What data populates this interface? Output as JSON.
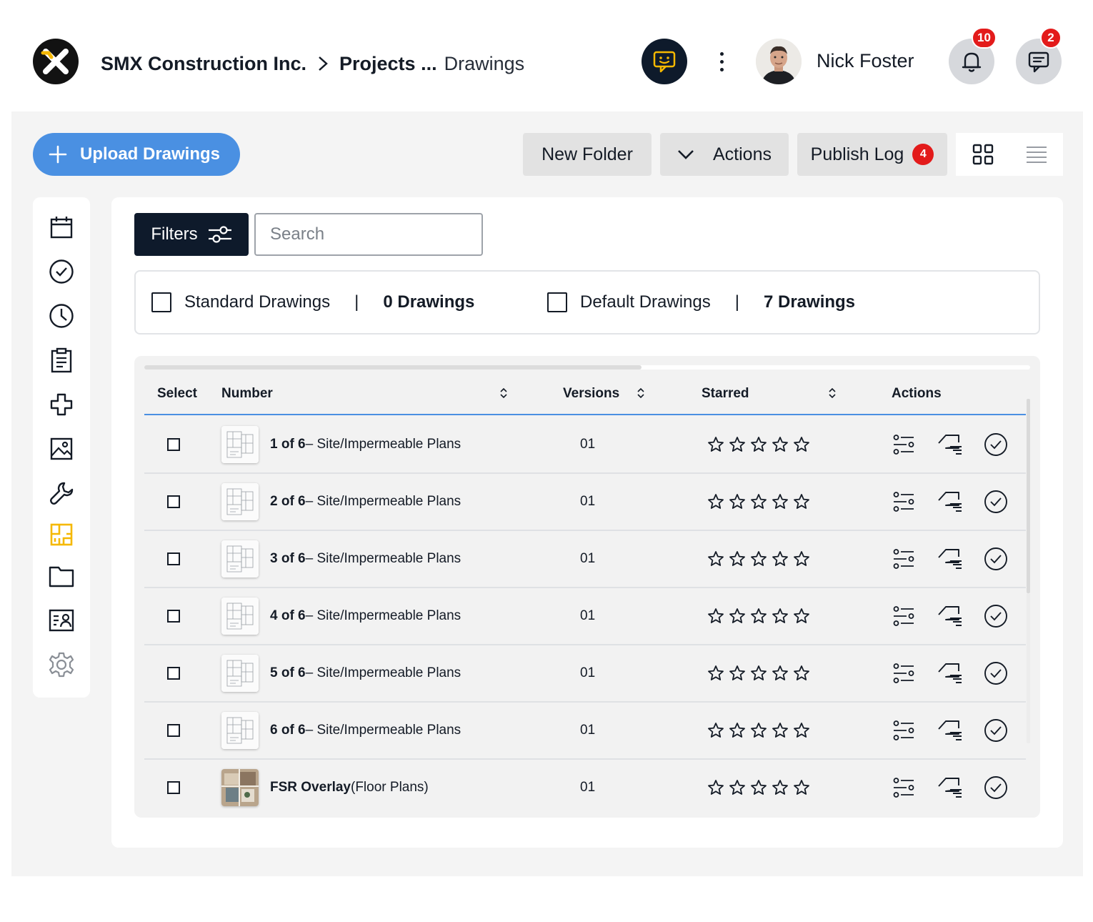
{
  "header": {
    "company": "SMX Construction Inc.",
    "section": "Projects ...",
    "page": "Drawings",
    "user_name": "Nick Foster",
    "notifications_count": "10",
    "messages_count": "2"
  },
  "toolbar": {
    "upload_label": "Upload Drawings",
    "new_folder_label": "New Folder",
    "actions_label": "Actions",
    "publish_log_label": "Publish Log",
    "publish_log_count": "4"
  },
  "sidebar": {
    "items": [
      {
        "name": "calendar-icon",
        "active": false
      },
      {
        "name": "check-circle-icon",
        "active": false
      },
      {
        "name": "clock-icon",
        "active": false
      },
      {
        "name": "clipboard-icon",
        "active": false
      },
      {
        "name": "medical-cross-icon",
        "active": false
      },
      {
        "name": "image-icon",
        "active": false
      },
      {
        "name": "wrench-icon",
        "active": false
      },
      {
        "name": "drawings-icon",
        "active": true
      },
      {
        "name": "folder-icon",
        "active": false
      },
      {
        "name": "contact-card-icon",
        "active": false
      },
      {
        "name": "settings-icon",
        "active": false
      }
    ],
    "active_color": "#f5b800"
  },
  "filters": {
    "filters_label": "Filters",
    "search_placeholder": "Search"
  },
  "summary": {
    "standard_label": "Standard Drawings",
    "standard_count": "0 Drawings",
    "default_label": "Default Drawings",
    "default_count": "7 Drawings",
    "separator": "|"
  },
  "table": {
    "headers": {
      "select": "Select",
      "number": "Number",
      "versions": "Versions",
      "starred": "Starred",
      "actions": "Actions"
    },
    "rows": [
      {
        "number_bold": "1 of 6",
        "number_rest": " – Site/Impermeable Plans",
        "version": "01",
        "stars": 0,
        "thumb": "plan"
      },
      {
        "number_bold": "2 of 6",
        "number_rest": " – Site/Impermeable Plans",
        "version": "01",
        "stars": 0,
        "thumb": "plan"
      },
      {
        "number_bold": "3 of 6",
        "number_rest": " – Site/Impermeable Plans",
        "version": "01",
        "stars": 0,
        "thumb": "plan"
      },
      {
        "number_bold": "4 of 6",
        "number_rest": " – Site/Impermeable Plans",
        "version": "01",
        "stars": 0,
        "thumb": "plan"
      },
      {
        "number_bold": "5 of 6",
        "number_rest": " – Site/Impermeable Plans",
        "version": "01",
        "stars": 0,
        "thumb": "plan"
      },
      {
        "number_bold": "6 of 6",
        "number_rest": " – Site/Impermeable Plans",
        "version": "01",
        "stars": 0,
        "thumb": "plan"
      },
      {
        "number_bold": "FSR Overlay",
        "number_rest": " (Floor Plans)",
        "version": "01",
        "stars": 0,
        "thumb": "render"
      }
    ]
  },
  "colors": {
    "primary": "#4a90e2",
    "dark": "#0e1a2b",
    "badge": "#e31b1b",
    "accent": "#f5b800"
  }
}
